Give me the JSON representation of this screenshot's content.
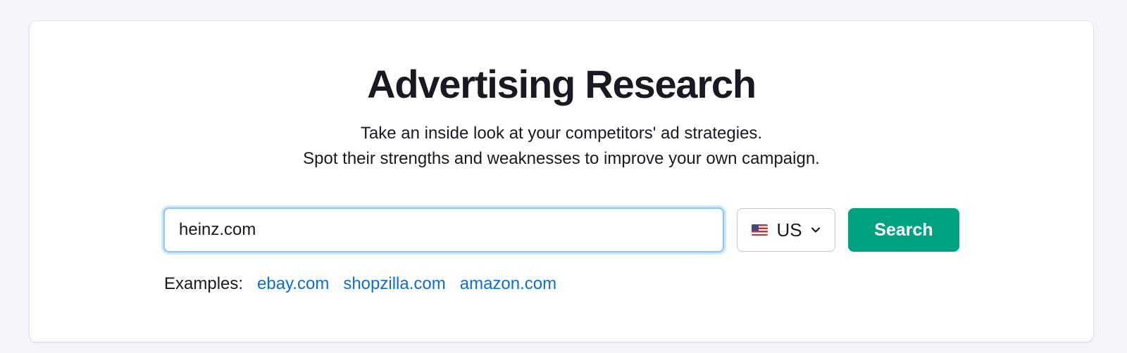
{
  "page": {
    "title": "Advertising Research",
    "subtitle_line1": "Take an inside look at your competitors' ad strategies.",
    "subtitle_line2": "Spot their strengths and weaknesses to improve your own campaign."
  },
  "search": {
    "value": "heinz.com",
    "button_label": "Search"
  },
  "database": {
    "selected": "US",
    "flag_icon": "us-flag-icon"
  },
  "examples": {
    "label": "Examples:",
    "links": [
      "ebay.com",
      "shopzilla.com",
      "amazon.com"
    ]
  },
  "colors": {
    "accent": "#00a27f",
    "link": "#0a6fd1",
    "focus_border": "#8ec3f5"
  }
}
